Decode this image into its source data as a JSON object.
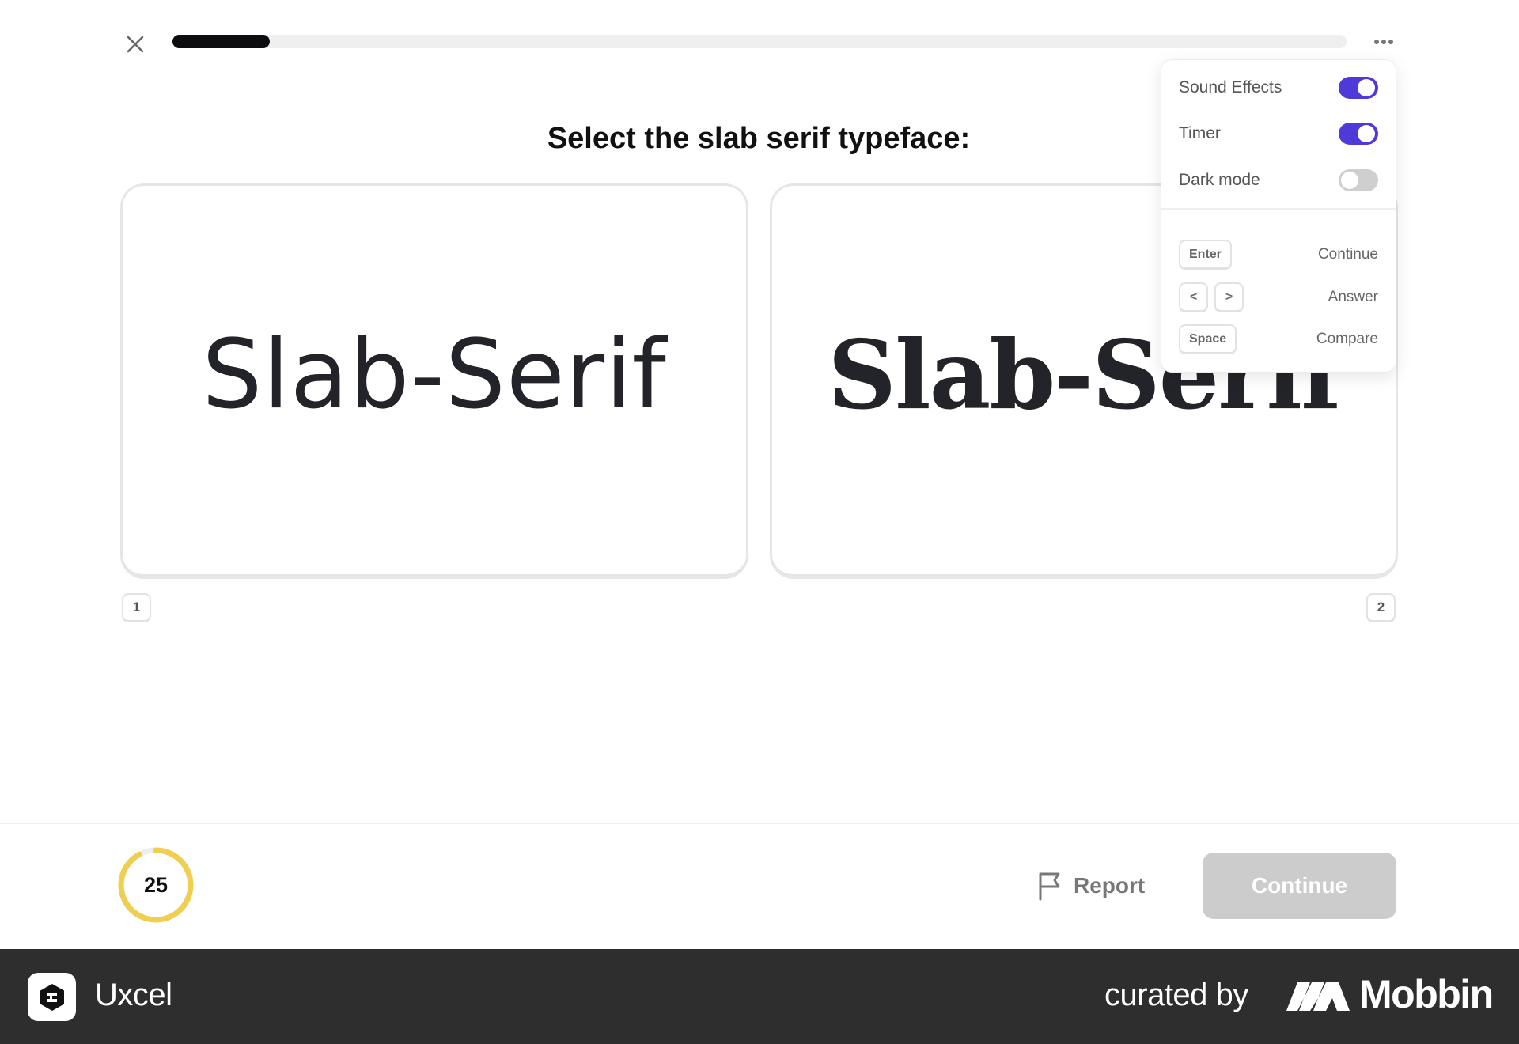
{
  "progress": {
    "value_percent": 8.3
  },
  "question": {
    "text": "Select the slab serif typeface:"
  },
  "options": [
    {
      "text": "Slab-Serif",
      "key": "1"
    },
    {
      "text": "Slab-Serif",
      "key": "2"
    }
  ],
  "settings": {
    "toggles": [
      {
        "label": "Sound Effects",
        "on": true
      },
      {
        "label": "Timer",
        "on": true
      },
      {
        "label": "Dark mode",
        "on": false
      }
    ],
    "shortcuts": [
      {
        "keys": [
          "Enter"
        ],
        "action": "Continue"
      },
      {
        "keys": [
          "<",
          ">"
        ],
        "action": "Answer"
      },
      {
        "keys": [
          "Space"
        ],
        "action": "Compare"
      }
    ]
  },
  "timer": {
    "value": "25",
    "remaining_fraction": 0.92,
    "color": "#f0ce4f"
  },
  "footer": {
    "report_label": "Report",
    "continue_label": "Continue"
  },
  "credit": {
    "app_name": "Uxcel",
    "curated_by": "curated by",
    "curator": "Mobbin"
  },
  "colors": {
    "accent": "#4f39d9",
    "progress": "#0d0d0f",
    "continue_disabled": "#cccccc"
  },
  "icons": {
    "close": "close-icon",
    "more": "more-horizontal-icon",
    "flag": "flag-icon",
    "logo": "uxcel-logo-icon",
    "mobbin": "mobbin-logo-icon"
  }
}
